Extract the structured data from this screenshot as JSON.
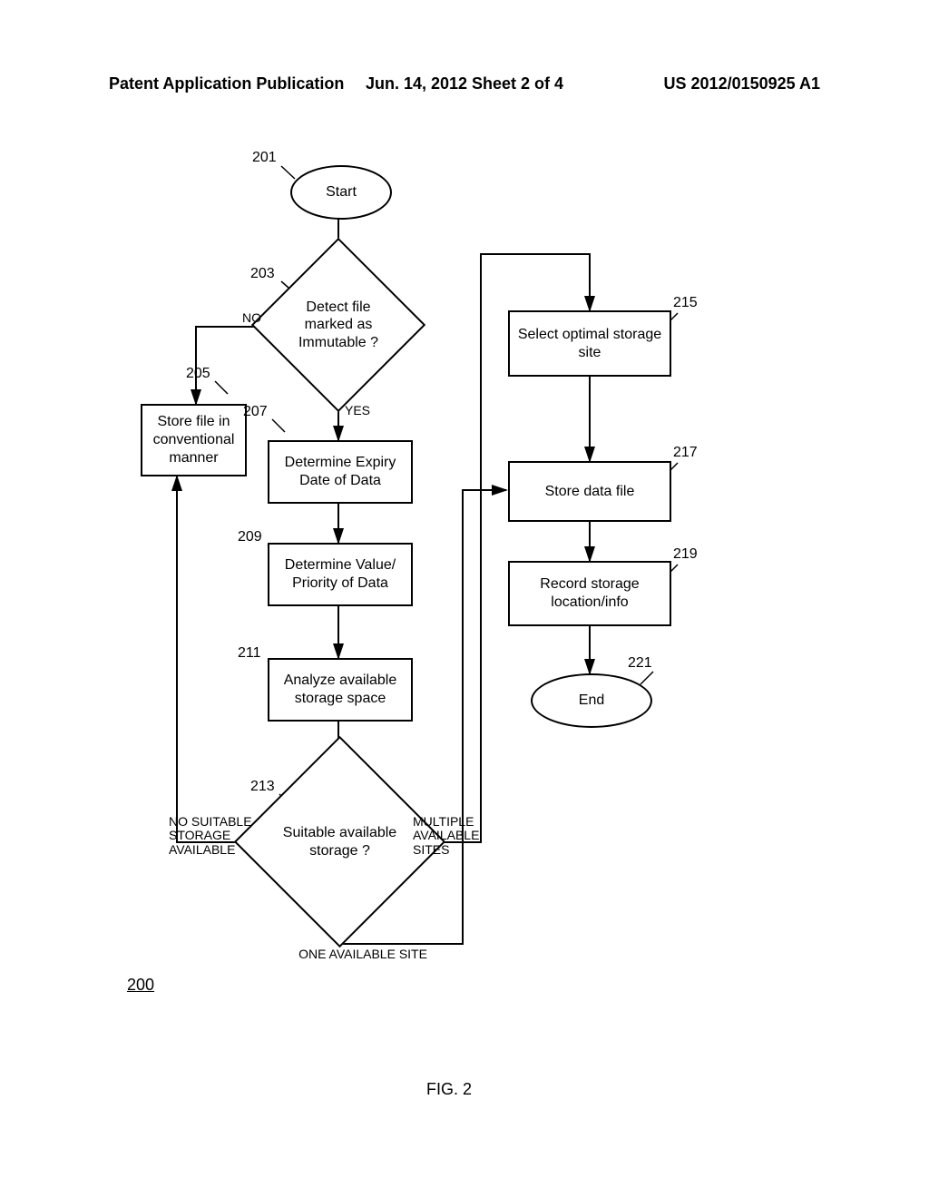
{
  "header": {
    "left": "Patent Application Publication",
    "center": "Jun. 14, 2012  Sheet 2 of 4",
    "right": "US 2012/0150925 A1"
  },
  "nodes": {
    "start": {
      "ref": "201",
      "label": "Start"
    },
    "detectImmutable": {
      "ref": "203",
      "label": "Detect file marked as Immutable ?",
      "edges": {
        "no": "NO",
        "yes": "YES"
      }
    },
    "storeConventional": {
      "ref": "205",
      "label": "Store file in conventional manner"
    },
    "determineExpiry": {
      "ref": "207",
      "label": "Determine Expiry Date of Data"
    },
    "determineValue": {
      "ref": "209",
      "label": "Determine Value/ Priority of Data"
    },
    "analyzeSpace": {
      "ref": "211",
      "label": "Analyze available storage space"
    },
    "suitableStorage": {
      "ref": "213",
      "label": "Suitable available storage ?",
      "edges": {
        "none": "NO SUITABLE STORAGE AVAILABLE",
        "one": "ONE AVAILABLE SITE",
        "many": "MULTIPLE AVAILABLE SITES"
      }
    },
    "selectOptimal": {
      "ref": "215",
      "label": "Select optimal storage site"
    },
    "storeData": {
      "ref": "217",
      "label": "Store data file"
    },
    "recordInfo": {
      "ref": "219",
      "label": "Record storage location/info"
    },
    "end": {
      "ref": "221",
      "label": "End"
    }
  },
  "figure": {
    "ref": "200",
    "caption": "FIG. 2"
  }
}
